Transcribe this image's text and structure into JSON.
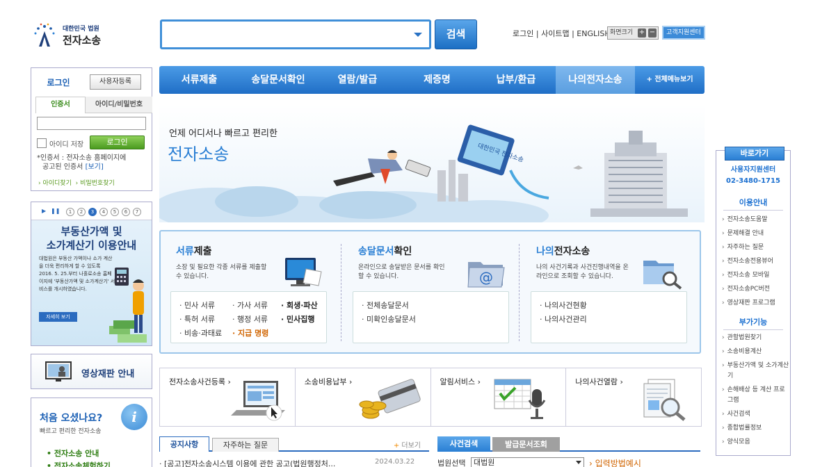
{
  "header": {
    "logo_small": "대한민국 법원",
    "logo_large": "전자소송",
    "search_placeholder": "",
    "search_button": "검색",
    "links": [
      "로그인",
      "|",
      "사이트맵",
      "|",
      "ENGLISH"
    ],
    "font_size_label": "화면크기",
    "font_plus": "+",
    "font_minus": "−",
    "help_center": "고객지원센터"
  },
  "nav": {
    "items": [
      "서류제출",
      "송달문서확인",
      "열람/발급",
      "제증명",
      "납부/환급",
      "나의전자소송"
    ],
    "all_menu": "+ 전체메뉴보기"
  },
  "login": {
    "tab_login": "로그인",
    "register": "사용자등록",
    "tab_cert": "인증서",
    "tab_id": "아이디/비밀번호",
    "save_id": "아이디 저장",
    "login_button": "로그인",
    "cert_note_a": "*인증서 : 전자소송 홈페이지에",
    "cert_note_b": "공고된 인증서",
    "cert_note_link": "[보기]",
    "find_id": "› 아이디찾기",
    "find_pw": "› 비밀번호찾기"
  },
  "promo": {
    "play": "▶",
    "pause": "❚❚",
    "pages": [
      "1",
      "2",
      "3",
      "4",
      "5",
      "6",
      "7"
    ],
    "title_1": "부동산가액 및",
    "title_2": "소가계산기 이용안내",
    "desc": "대법원은 부동산 가액이나 소가 계산을 더욱 편리하게 할 수 있도록 2016. 5. 25.부터 나홀로소송 홈페이지에 '부동산가액 및 소가계산기' 서비스를 개시하였습니다.",
    "more": "자세히 보기"
  },
  "video": {
    "label": "영상재판 안내"
  },
  "first_visit": {
    "title": "처음 오셨나요?",
    "sub": "빠르고 편리한 전자소송",
    "info": "i",
    "link1": "• 전자소송 안내",
    "link2": "• 전자소송체험하기"
  },
  "banner": {
    "sub": "언제 어디서나 빠르고 편리한",
    "title": "전자소송",
    "monitor_text": "대한민국 전자소송"
  },
  "services": [
    {
      "hl": "서류",
      "rest": "제출",
      "desc": "소장 및 필요한 각종 서류를 제출할 수 있습니다.",
      "items": [
        "· 민사 서류",
        "· 가사 서류",
        "· 회생·파산",
        "· 특허 서류",
        "· 행정 서류",
        "· 민사집행",
        "· 비송·과태료",
        "· 지급 명령"
      ]
    },
    {
      "hl": "송달문서",
      "rest": "확인",
      "desc": "온라인으로 송달받은 문서를 확인 할 수 있습니다.",
      "items": [
        "· 전체송달문서",
        "· 미확인송달문서"
      ]
    },
    {
      "hl": "나의",
      "rest": "전자소송",
      "desc": "나의 사건기록과 사건진행내역을 온라인으로 조회할 수 있습니다.",
      "items": [
        "· 나의사건현황",
        "· 나의사건관리"
      ]
    }
  ],
  "quick_cards": [
    "전자소송사건등록 ›",
    "소송비용납부 ›",
    "알림서비스 ›",
    "나의사건열람 ›"
  ],
  "notice": {
    "tab_notice": "공지사항",
    "tab_faq": "자주하는 질문",
    "more": "더보기",
    "more_icon": "+",
    "first_title": "· [공고]전자소송시스템 이용에 관한 공고(법원행정처...",
    "first_date": "2024.03.22"
  },
  "case_search": {
    "tab_case": "사건검색",
    "tab_doc": "발급문서조회",
    "court_label": "법원선택",
    "court_value": "대법원",
    "input_help": "› 입력방법예시"
  },
  "quick_links": {
    "title": "바로가기",
    "center": "사용자지원센터",
    "phone": "02-3480-1715",
    "head_usage": "이용안내",
    "usage": [
      "전자소송도움말",
      "문제해결 안내",
      "자주하는 질문",
      "전자소송전용뷰어",
      "전자소송 모바일",
      "전자소송PC버전",
      "영상재판 프로그램"
    ],
    "head_extra": "부가기능",
    "extra": [
      "관할법원찾기",
      "소송비용계산",
      "부동산가액 및 소가계산기",
      "손해배상 등 계산 프로그램",
      "사건검색",
      "종합법률정보",
      "양식모음"
    ]
  },
  "colors": {
    "brand_blue": "#2a7fd4",
    "nav_blue": "#1f6ec6",
    "green": "#4a9a1f",
    "orange": "#d06400"
  }
}
